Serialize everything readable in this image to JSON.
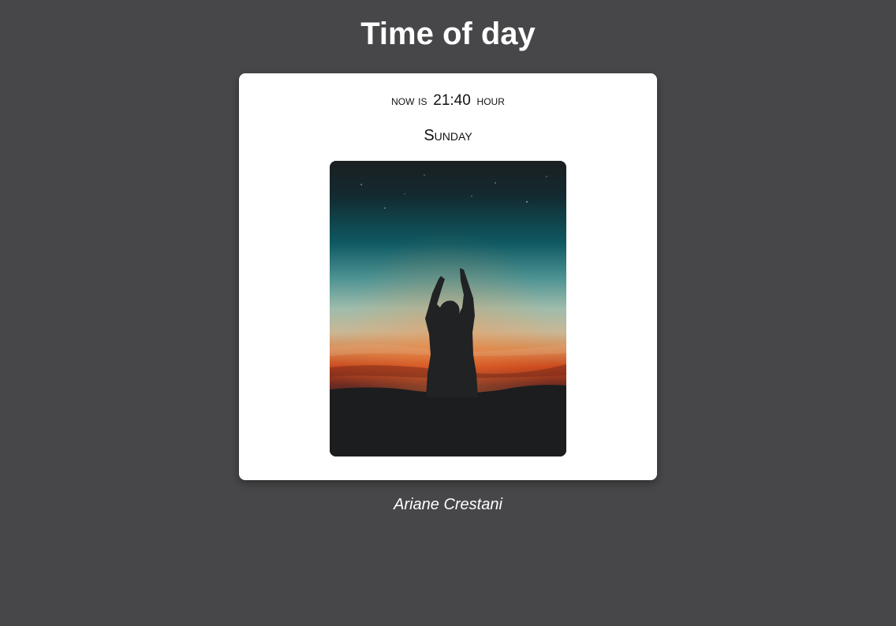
{
  "header": {
    "title": "Time of day"
  },
  "card": {
    "prefix": "now is",
    "time": "21:40",
    "suffix": "hour",
    "weekday": "Sunday",
    "image": {
      "description_icon": "night-sky-photo",
      "alt": "Silhouette reaching toward a crescent moon at dusk"
    }
  },
  "footer": {
    "author": "Ariane Crestani"
  },
  "colors": {
    "background": "#474749",
    "card": "#ffffff",
    "text_light": "#ffffff",
    "text_dark": "#111111"
  }
}
